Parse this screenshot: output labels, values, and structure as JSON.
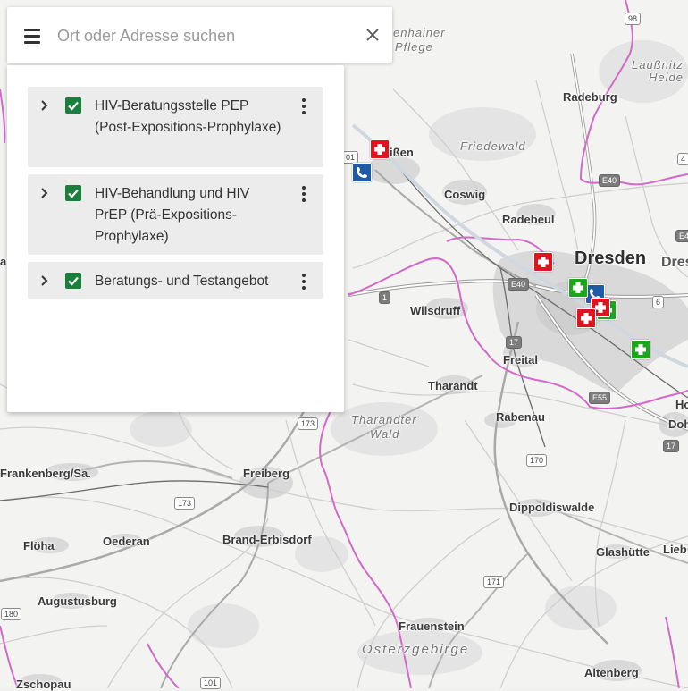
{
  "search": {
    "placeholder": "Ort oder Adresse suchen",
    "value": ""
  },
  "layers": [
    {
      "label": "HIV-Beratungsstelle PEP (Post-Expositions-Prophylaxe)",
      "checked": true
    },
    {
      "label": "HIV-Behandlung und HIV PrEP (Prä-Expositions-Prophylaxe)",
      "checked": true
    },
    {
      "label": "Beratungs- und Testangebot",
      "checked": true
    }
  ],
  "map": {
    "places": [
      "Dresden",
      "Dresd",
      "Radeburg",
      "Meißen",
      "Coswig",
      "Radebeul",
      "Wilsdruff",
      "Freital",
      "Tharandt",
      "Rabenau",
      "Frankenberg/Sa.",
      "Freiberg",
      "Flöha",
      "Oederan",
      "Brand-Erbisdorf",
      "Augustusburg",
      "Dippoldiswalde",
      "Glashütte",
      "Liebs",
      "Frauenstein",
      "Altenberg",
      "Zschopau",
      "Doh",
      "Ho",
      "al"
    ],
    "regions": [
      "Friedewald",
      "Tharandter",
      "Wald",
      "Osterzgebirge",
      "Laußnitz",
      "Heide",
      "enhainer",
      "Pflege"
    ],
    "road_numbers": [
      "98",
      "4",
      "E40",
      "6",
      "1",
      "17",
      "E40",
      "173",
      "170",
      "173",
      "171",
      "180",
      "101",
      "E55",
      "17",
      "01",
      "E4"
    ],
    "colors": {
      "marker_red": "#e0141e",
      "marker_green": "#1ba61b",
      "marker_blue": "#1f5aa8",
      "boundary": "#d26ac8",
      "checkbox": "#1b7f3c"
    },
    "marker_icons": [
      "medical-cross-icon",
      "phone-icon"
    ]
  }
}
